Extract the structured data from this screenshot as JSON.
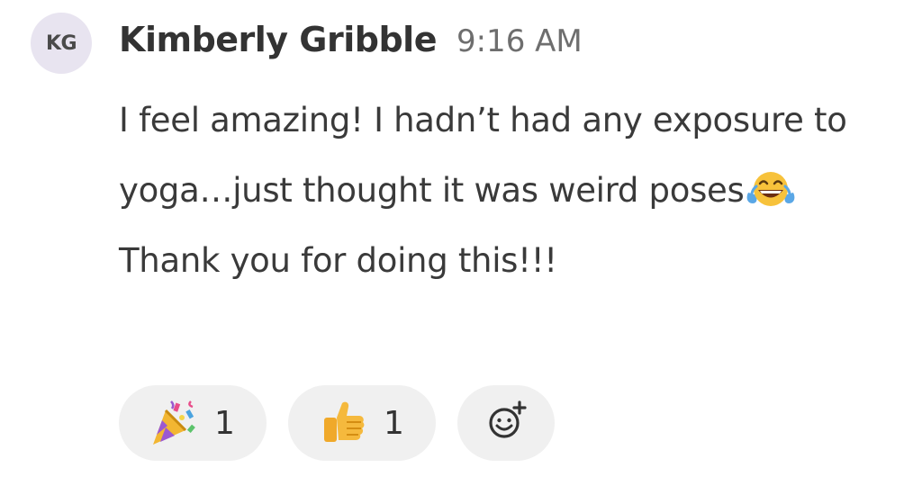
{
  "message": {
    "avatar_initials": "KG",
    "author": "Kimberly Gribble",
    "time": "9:16 AM",
    "text_before_emoji": "I feel amazing! I hadn’t had any exposure to yoga…just thought it was weird poses",
    "inline_emoji": "laughing-crying-emoji",
    "text_after_emoji": "Thank you for doing this!!!"
  },
  "reactions": [
    {
      "emoji": "party-popper",
      "count": "1"
    },
    {
      "emoji": "thumbs-up",
      "count": "1"
    }
  ],
  "add_reaction_icon": "add-emoji-icon",
  "colors": {
    "avatar_bg": "#e8e4f0",
    "pill_bg": "#f0f0f0",
    "text": "#3a3a3a",
    "timestamp": "#6e6e6e"
  }
}
